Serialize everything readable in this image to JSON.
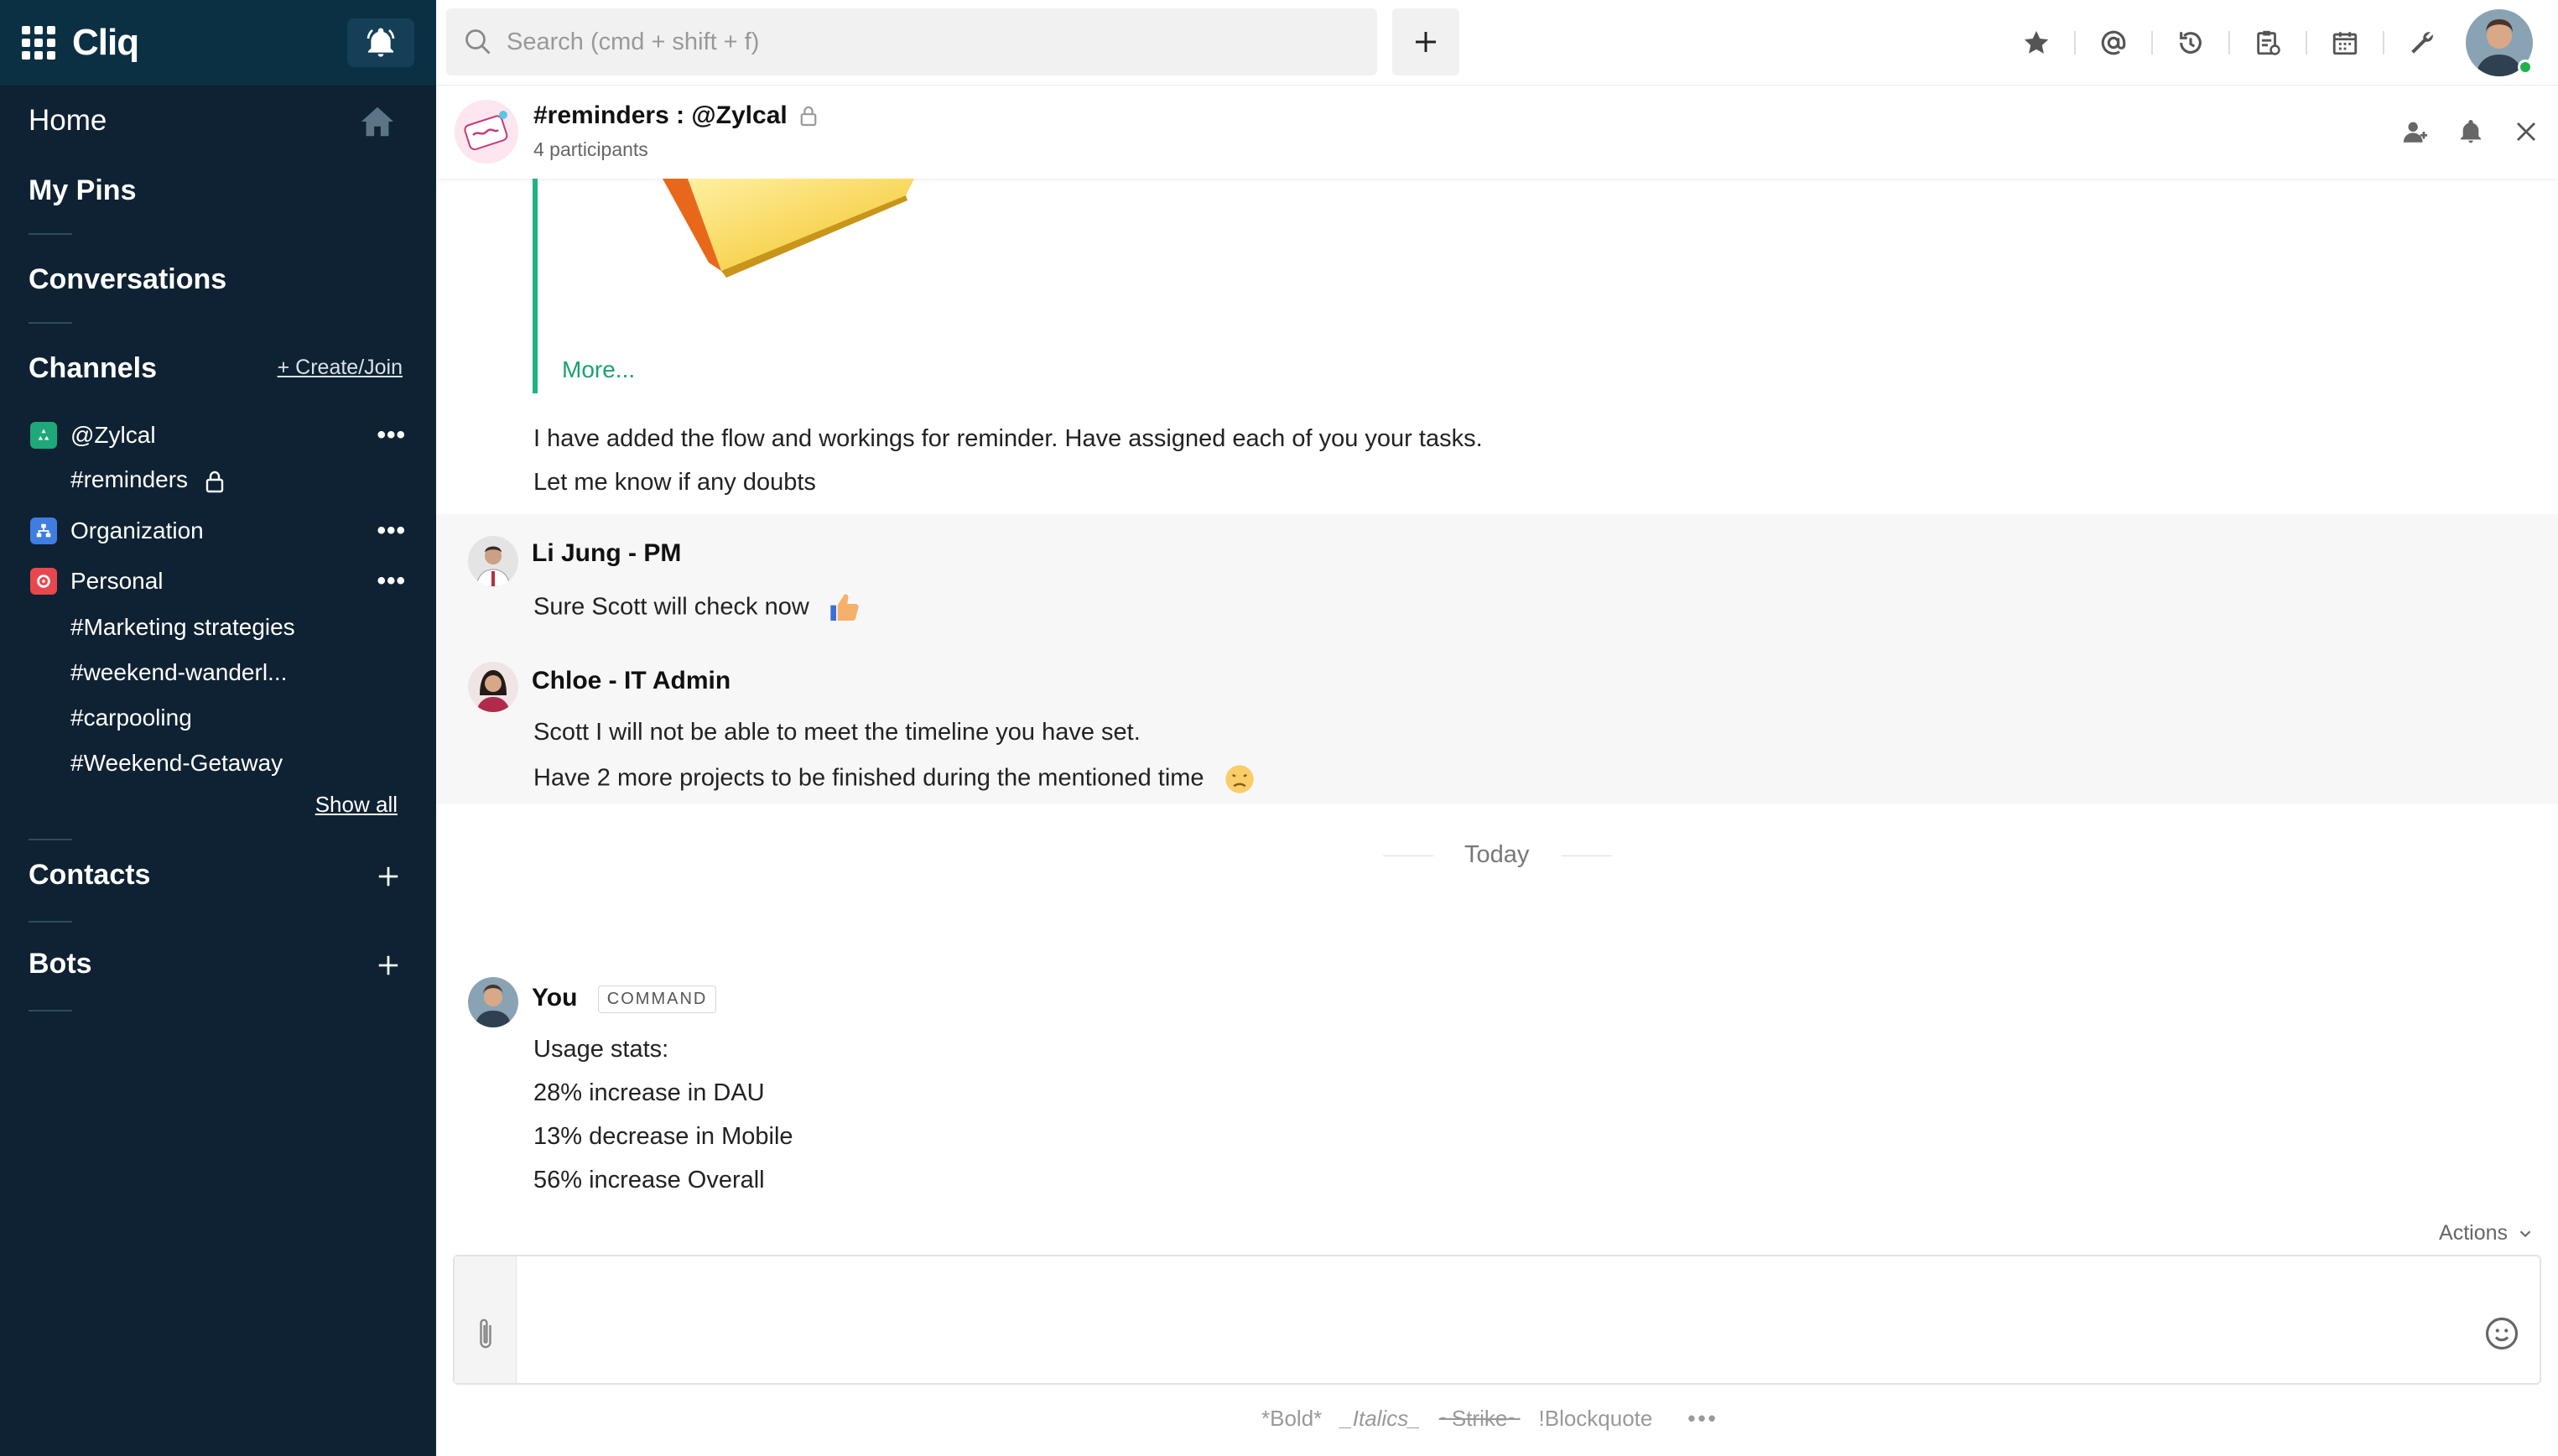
{
  "app": {
    "brand": "Cliq"
  },
  "sidebar": {
    "home": "Home",
    "my_pins": "My Pins",
    "conversations": "Conversations",
    "channels": "Channels",
    "create_join": "+ Create/Join",
    "groups": [
      {
        "label": "@Zylcal",
        "color": "#1fa87a",
        "channels": [
          "#reminders"
        ]
      },
      {
        "label": "Organization",
        "color": "#3f7de0",
        "channels": []
      },
      {
        "label": "Personal",
        "color": "#e8474d",
        "channels": [
          "#Marketing strategies",
          "#weekend-wanderl...",
          "#carpooling",
          "#Weekend-Getaway"
        ]
      }
    ],
    "show_all": "Show all",
    "contacts": "Contacts",
    "bots": "Bots",
    "menu_dots": "•••"
  },
  "topbar": {
    "search_placeholder": "Search (cmd + shift + f)",
    "icons": [
      "star-icon",
      "mention-icon",
      "history-icon",
      "clipboard-icon",
      "calendar-icon",
      "tools-icon"
    ]
  },
  "chat": {
    "title": "#reminders : @Zylcal",
    "participants": "4 participants",
    "preview_more": "More...",
    "messages_prev": [
      "I have added the flow and workings for reminder. Have assigned each of you your tasks.",
      "Let me know if any doubts"
    ],
    "li_jung": {
      "name": "Li Jung - PM",
      "text": "Sure Scott will check now"
    },
    "chloe": {
      "name": "Chloe - IT Admin",
      "lines": [
        "Scott I will not be able to meet the timeline you have set.",
        "Have 2 more projects to be finished during the mentioned time"
      ]
    },
    "day_separator": "Today",
    "you": {
      "name": "You",
      "tag": "COMMAND",
      "lines": [
        "Usage stats:",
        "28% increase in DAU",
        "13% decrease in Mobile",
        "56% increase Overall"
      ]
    }
  },
  "composer": {
    "actions_label": "Actions",
    "format": [
      "*Bold*",
      "_Italics_",
      "~Strike~",
      "!Blockquote"
    ],
    "more": "•••"
  },
  "colors": {
    "sidebar_bg": "#0e2233",
    "sidebar_top": "#0b3044",
    "accent_green": "#1aa36d"
  }
}
